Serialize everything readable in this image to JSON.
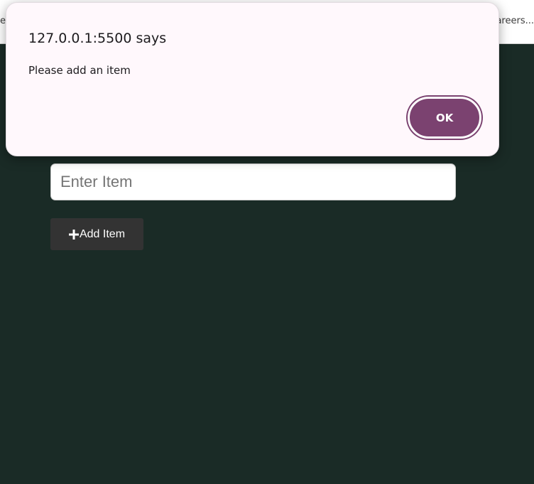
{
  "browser": {
    "bookmarks_left_fragment": "e",
    "bookmarks_right_fragment": "areers..."
  },
  "app": {
    "input_placeholder": "Enter Item",
    "input_value": "",
    "add_button_label": "Add Item",
    "add_button_icon": "plus-icon",
    "background_color": "#1a2b26"
  },
  "dialog": {
    "title": "127.0.0.1:5500 says",
    "message": "Please add an item",
    "ok_label": "OK",
    "accent_color": "#7b4270"
  }
}
